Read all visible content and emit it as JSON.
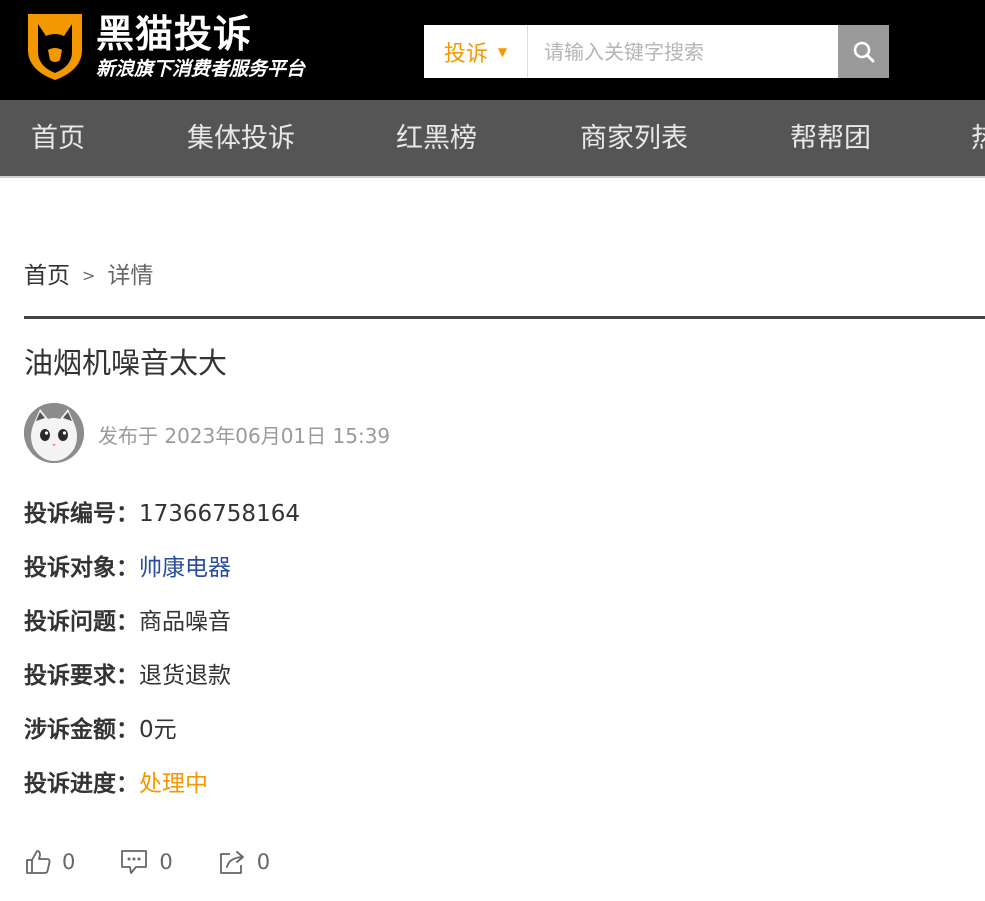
{
  "header": {
    "logo_title": "黑猫投诉",
    "logo_subtitle": "新浪旗下消费者服务平台",
    "search": {
      "category": "投诉",
      "placeholder": "请输入关键字搜索"
    }
  },
  "nav": {
    "items": [
      {
        "label": "首页"
      },
      {
        "label": "集体投诉"
      },
      {
        "label": "红黑榜"
      },
      {
        "label": "商家列表"
      },
      {
        "label": "帮帮团"
      },
      {
        "label": "热"
      }
    ]
  },
  "breadcrumb": {
    "home": "首页",
    "separator": ">",
    "current": "详情"
  },
  "complaint": {
    "title": "油烟机噪音太大",
    "published": "发布于 2023年06月01日 15:39",
    "fields": [
      {
        "key": "投诉编号：",
        "value": "17366758164"
      },
      {
        "key": "投诉对象：",
        "value": "帅康电器"
      },
      {
        "key": "投诉问题：",
        "value": "商品噪音"
      },
      {
        "key": "投诉要求：",
        "value": "退货退款"
      },
      {
        "key": "涉诉金额：",
        "value": "0元"
      },
      {
        "key": "投诉进度：",
        "value": "处理中"
      }
    ]
  },
  "actions": {
    "likes": "0",
    "comments": "0",
    "shares": "0"
  },
  "colors": {
    "accent": "#f39800",
    "link": "#2b4d9c",
    "nav_bg": "#555555",
    "header_bg": "#000000"
  }
}
